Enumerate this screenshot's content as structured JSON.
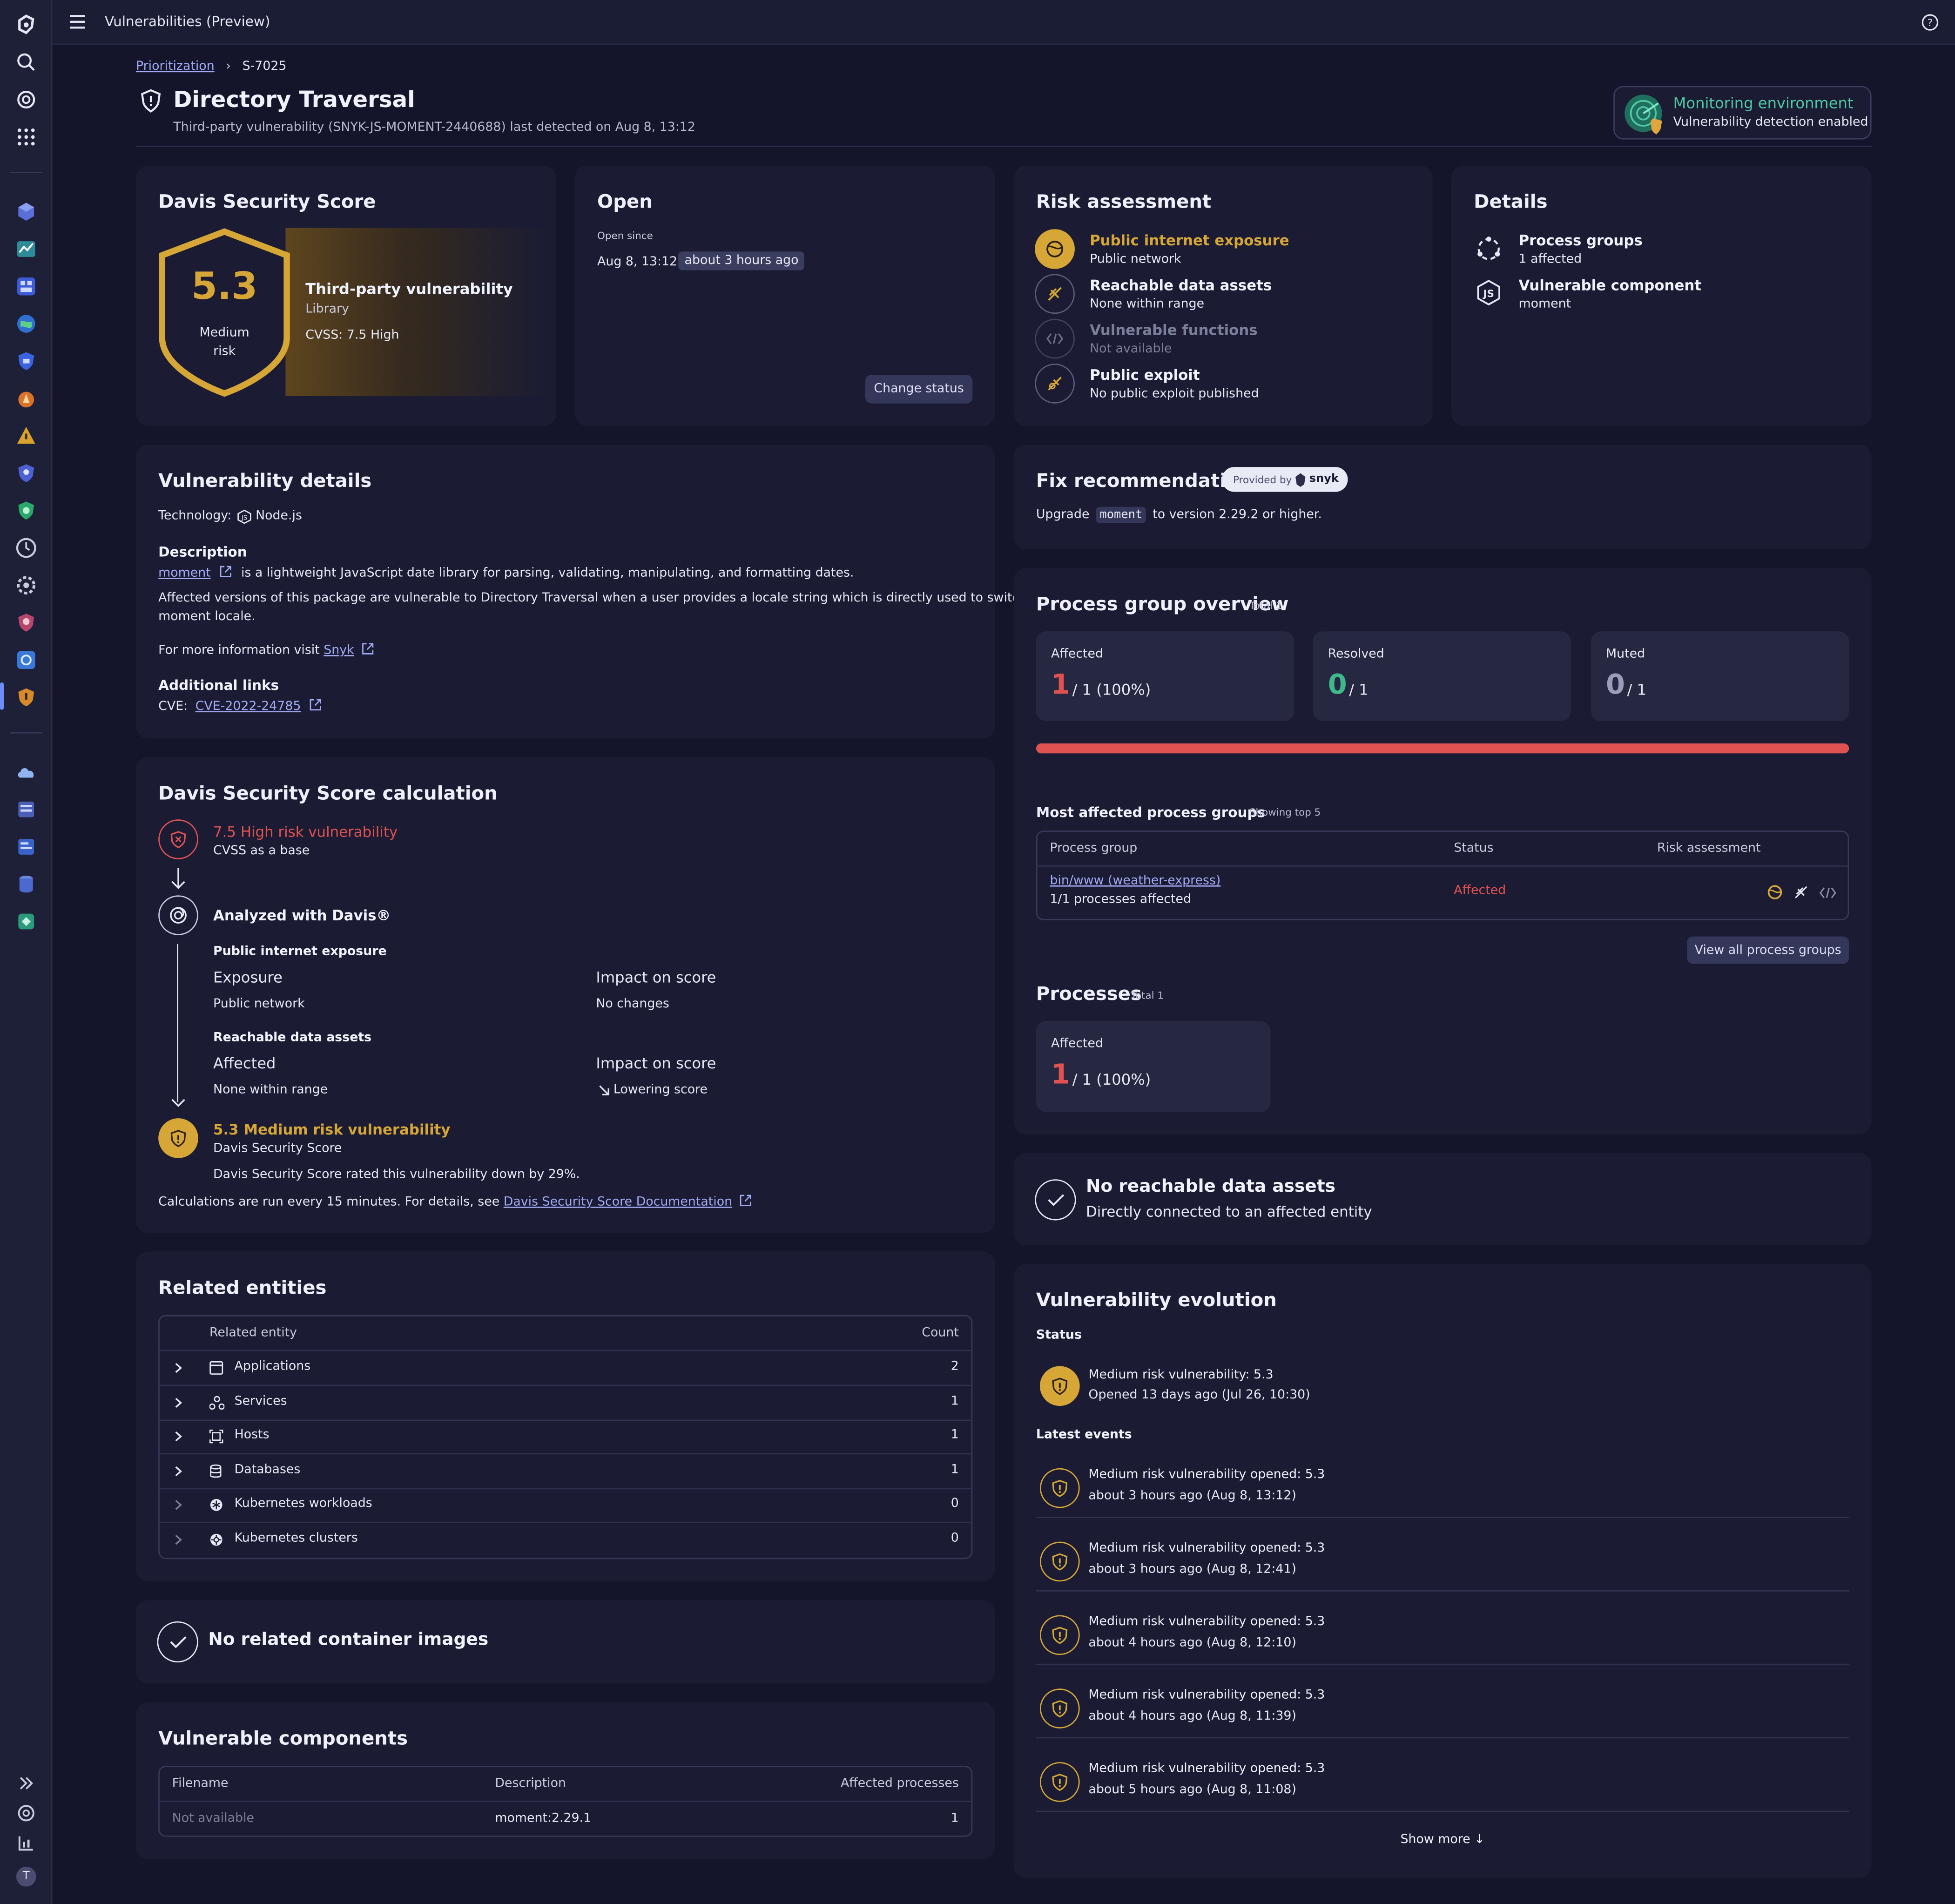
{
  "app": {
    "title": "Vulnerabilities (Preview)"
  },
  "breadcrumb": {
    "parent": "Prioritization",
    "current": "S-7025"
  },
  "page": {
    "title": "Directory Traversal",
    "subtitle": "Third-party vulnerability (SNYK-JS-MOMENT-2440688) last detected on Aug 8, 13:12"
  },
  "monitoring": {
    "title": "Monitoring environment",
    "subtitle": "Vulnerability detection enabled"
  },
  "dss": {
    "title": "Davis Security Score",
    "score": "5.3",
    "risk": "Medium risk",
    "type": "Third-party vulnerability",
    "category": "Library",
    "cvss": "CVSS: 7.5 High"
  },
  "open": {
    "title": "Open",
    "since_label": "Open since",
    "date": "Aug 8, 13:12",
    "relative": "about 3 hours ago",
    "button": "Change status"
  },
  "risk_assessment": {
    "title": "Risk assessment",
    "items": [
      {
        "label": "Public internet exposure",
        "value": "Public network"
      },
      {
        "label": "Reachable data assets",
        "value": "None within range"
      },
      {
        "label": "Vulnerable functions",
        "value": "Not available"
      },
      {
        "label": "Public exploit",
        "value": "No public exploit published"
      }
    ]
  },
  "details": {
    "title": "Details",
    "items": [
      {
        "label": "Process groups",
        "value": "1 affected"
      },
      {
        "label": "Vulnerable component",
        "value": "moment"
      }
    ]
  },
  "vuln_details": {
    "title": "Vulnerability details",
    "technology_label": "Technology:",
    "technology": "Node.js",
    "description_heading": "Description",
    "lib_link": "moment",
    "description_rest": "is a lightweight JavaScript date library for parsing, validating, manipulating, and formatting dates.",
    "affected_text_1": "Affected versions of this package are vulnerable to Directory Traversal when a user provides a locale string which is directly used to switch",
    "affected_text_2": "moment locale.",
    "more_info_label": "For more information visit",
    "more_info_link": "Snyk",
    "links_heading": "Additional links",
    "cve_label": "CVE:",
    "cve_link": "CVE-2022-24785"
  },
  "fix": {
    "title": "Fix recommendation",
    "provided_by": "Provided by",
    "provider": "snyk",
    "text_pre": "Upgrade",
    "package": "moment",
    "text_post": "to version 2.29.2 or higher."
  },
  "pg_overview": {
    "title": "Process group overview",
    "total": "Total 1",
    "tiles": [
      {
        "label": "Affected",
        "value": "1",
        "suffix": "/ 1 (100%)"
      },
      {
        "label": "Resolved",
        "value": "0",
        "suffix": "/ 1"
      },
      {
        "label": "Muted",
        "value": "0",
        "suffix": "/ 1"
      }
    ],
    "affected_fraction": 1.0,
    "most_affected_title": "Most affected process groups",
    "most_affected_note": "Showing top 5",
    "columns": [
      "Process group",
      "Status",
      "Risk assessment"
    ],
    "rows": [
      {
        "name": "bin/www (weather-express)",
        "sub": "1/1 processes affected",
        "status": "Affected"
      }
    ],
    "view_all": "View all process groups",
    "processes_title": "Processes",
    "processes_total": "Total 1",
    "processes_tile": {
      "label": "Affected",
      "value": "1",
      "suffix": "/ 1 (100%)"
    }
  },
  "calc": {
    "title": "Davis Security Score calculation",
    "base_title": "7.5 High risk vulnerability",
    "base_sub": "CVSS as a base",
    "analyzed": "Analyzed with Davis®",
    "exposure_heading": "Public internet exposure",
    "exposure_label": "Exposure",
    "exposure_value": "Public network",
    "impact_label": "Impact on score",
    "exposure_impact": "No changes",
    "assets_heading": "Reachable data assets",
    "assets_label": "Affected",
    "assets_value": "None within range",
    "assets_impact_label": "Impact on score",
    "assets_impact": "Lowering score",
    "result_title": "5.3 Medium risk vulnerability",
    "result_sub": "Davis Security Score",
    "rated_text": "Davis Security Score rated this vulnerability down by 29%.",
    "footer_pre": "Calculations are run every 15 minutes. For details, see",
    "footer_link": "Davis Security Score Documentation"
  },
  "no_assets": {
    "title": "No reachable data assets",
    "sub": "Directly connected to an affected entity"
  },
  "related": {
    "title": "Related entities",
    "col_entity": "Related entity",
    "col_count": "Count",
    "rows": [
      {
        "name": "Applications",
        "count": "2"
      },
      {
        "name": "Services",
        "count": "1"
      },
      {
        "name": "Hosts",
        "count": "1"
      },
      {
        "name": "Databases",
        "count": "1"
      },
      {
        "name": "Kubernetes workloads",
        "count": "0"
      },
      {
        "name": "Kubernetes clusters",
        "count": "0"
      }
    ]
  },
  "evolution": {
    "title": "Vulnerability evolution",
    "status_heading": "Status",
    "status_title": "Medium risk vulnerability: 5.3",
    "status_sub": "Opened 13 days ago (Jul 26, 10:30)",
    "events_heading": "Latest events",
    "events": [
      {
        "title": "Medium risk vulnerability opened: 5.3",
        "sub": "about 3 hours ago (Aug 8, 13:12)"
      },
      {
        "title": "Medium risk vulnerability opened: 5.3",
        "sub": "about 3 hours ago (Aug 8, 12:41)"
      },
      {
        "title": "Medium risk vulnerability opened: 5.3",
        "sub": "about 4 hours ago (Aug 8, 12:10)"
      },
      {
        "title": "Medium risk vulnerability opened: 5.3",
        "sub": "about 4 hours ago (Aug 8, 11:39)"
      },
      {
        "title": "Medium risk vulnerability opened: 5.3",
        "sub": "about 5 hours ago (Aug 8, 11:08)"
      }
    ],
    "show_more": "Show more"
  },
  "no_images": {
    "title": "No related container images"
  },
  "components": {
    "title": "Vulnerable components",
    "columns": [
      "Filename",
      "Description",
      "Affected processes"
    ],
    "rows": [
      {
        "filename": "Not available",
        "description": "moment:2.29.1",
        "affected": "1"
      }
    ]
  },
  "user": {
    "initial": "T"
  },
  "colors": {
    "accent": "#d6a637",
    "danger": "#e05252",
    "success": "#3fb88a",
    "link": "#a3aaf5"
  }
}
